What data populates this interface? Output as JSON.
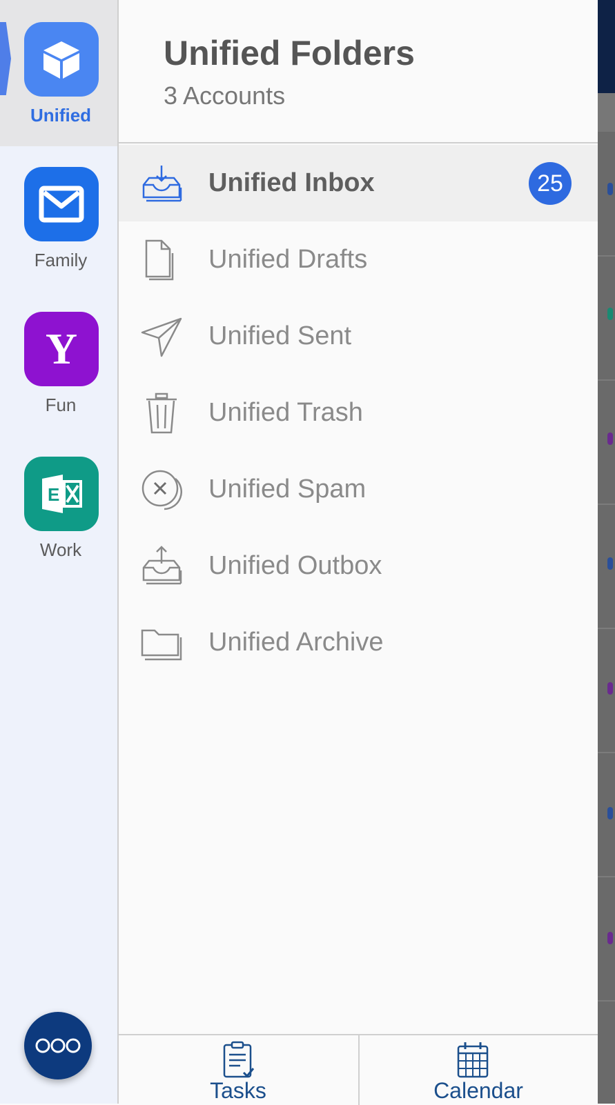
{
  "rail": {
    "accounts": [
      {
        "label": "Unified",
        "icon": "cube-icon",
        "color": "#4a86f2",
        "selected": true
      },
      {
        "label": "Family",
        "icon": "mail-icon",
        "color": "#1d6fe8",
        "selected": false
      },
      {
        "label": "Fun",
        "icon": "yahoo-icon",
        "color": "#8e12d0",
        "selected": false
      },
      {
        "label": "Work",
        "icon": "exchange-icon",
        "color": "#0f9b87",
        "selected": false
      }
    ],
    "fab_icon": "more-icon"
  },
  "panel": {
    "title": "Unified Folders",
    "subtitle": "3 Accounts",
    "folders": [
      {
        "label": "Unified Inbox",
        "icon": "inbox-icon",
        "badge": "25",
        "selected": true
      },
      {
        "label": "Unified Drafts",
        "icon": "document-icon",
        "selected": false
      },
      {
        "label": "Unified Sent",
        "icon": "send-icon",
        "selected": false
      },
      {
        "label": "Unified Trash",
        "icon": "trash-icon",
        "selected": false
      },
      {
        "label": "Unified Spam",
        "icon": "spam-icon",
        "selected": false
      },
      {
        "label": "Unified Outbox",
        "icon": "outbox-icon",
        "selected": false
      },
      {
        "label": "Unified Archive",
        "icon": "folder-icon",
        "selected": false
      }
    ]
  },
  "bottom_bar": {
    "tasks_label": "Tasks",
    "calendar_label": "Calendar"
  },
  "colors": {
    "accent": "#2e6ae0",
    "rail_bg": "#eef2fb",
    "fab": "#0d3a7e",
    "bottom_text": "#1b4f8c"
  }
}
